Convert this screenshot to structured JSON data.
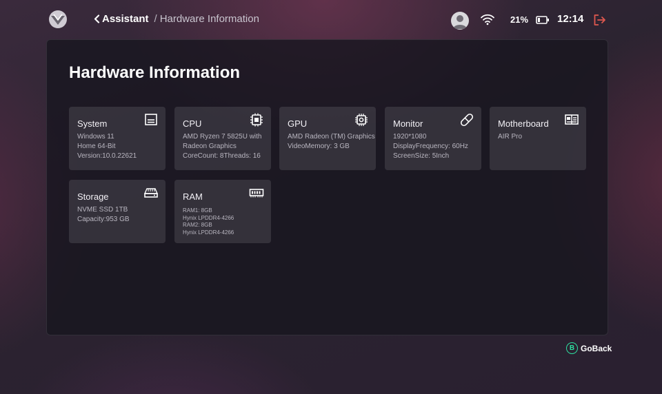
{
  "header": {
    "back_label": "Assistant",
    "separator": "/",
    "current": "Hardware Information",
    "battery_percent": "21%",
    "time": "12:14"
  },
  "icons": {
    "logo": "brand-logo-icon",
    "back": "chevron-left-icon",
    "avatar": "user-avatar-icon",
    "wifi": "wifi-icon",
    "battery": "battery-icon",
    "exit": "exit-icon",
    "system": "monitor-screen-icon",
    "cpu": "chip-icon",
    "gpu": "gpu-chip-icon",
    "monitor": "link-icon",
    "motherboard": "motherboard-icon",
    "storage": "drive-icon",
    "ram": "memory-stick-icon"
  },
  "colors": {
    "accent_green": "#2ee0a0",
    "exit_red": "#e0584f"
  },
  "page": {
    "title": "Hardware Information"
  },
  "cards": {
    "system": {
      "title": "System",
      "lines": [
        "Windows 11",
        "Home 64-Bit",
        "Version:10.0.22621"
      ]
    },
    "cpu": {
      "title": "CPU",
      "lines": [
        "AMD Ryzen 7 5825U with",
        "Radeon Graphics",
        "CoreCount: 8Threads: 16"
      ]
    },
    "gpu": {
      "title": "GPU",
      "lines": [
        "AMD Radeon (TM) Graphics",
        "VideoMemory: 3 GB"
      ]
    },
    "monitor": {
      "title": "Monitor",
      "lines": [
        "1920*1080",
        "DisplayFrequency: 60Hz",
        "ScreenSize: 5Inch"
      ]
    },
    "motherboard": {
      "title": "Motherboard",
      "lines": [
        "AIR Pro"
      ]
    },
    "storage": {
      "title": "Storage",
      "lines": [
        "NVME SSD 1TB",
        "Capacity:953 GB"
      ]
    },
    "ram": {
      "title": "RAM",
      "lines": [
        "RAM1: 8GB",
        "Hynix LPDDR4-4266",
        "RAM2: 8GB",
        "Hynix LPDDR4-4266"
      ]
    }
  },
  "footer": {
    "goback_key": "B",
    "goback_label": "GoBack"
  }
}
